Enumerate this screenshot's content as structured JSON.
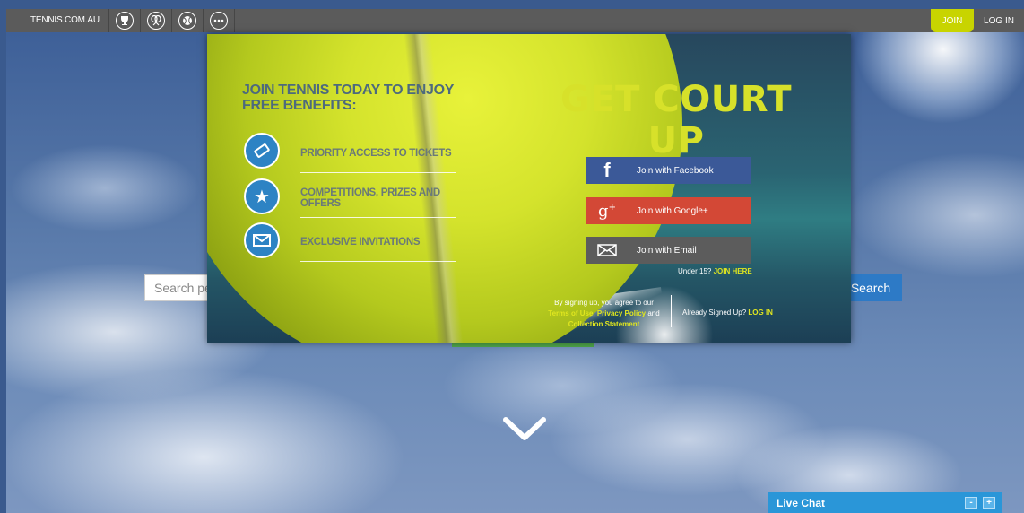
{
  "topbar": {
    "brand": "TENNIS.COM.AU",
    "icons": [
      "trophy-icon",
      "racquets-icon",
      "tennis-ball-icon",
      "more-icon"
    ],
    "join_label": "JOIN",
    "login_label": "LOG IN",
    "accent": "#c8d400"
  },
  "search": {
    "placeholder": "Search per",
    "button_label": "Search"
  },
  "modal": {
    "benefits_title": "JOIN TENNIS TODAY TO ENJOY FREE BENEFITS:",
    "benefits": [
      {
        "icon": "ticket-icon",
        "label": "PRIORITY ACCESS TO TICKETS"
      },
      {
        "icon": "star-icon",
        "label": "COMPETITIONS, PRIZES AND OFFERS"
      },
      {
        "icon": "envelope-icon",
        "label": "EXCLUSIVE INVITATIONS"
      }
    ],
    "headline": "GET COURT UP",
    "buttons": {
      "facebook": "Join with Facebook",
      "google": "Join with Google+",
      "email": "Join with Email"
    },
    "under15_prefix": "Under 15?",
    "under15_link": "JOIN HERE",
    "terms_prefix": "By signing up, you agree to our",
    "terms_link": "Terms of Use,",
    "privacy_link": "Privacy Policy",
    "terms_and": "and",
    "collection_link": "Collection Statement",
    "already_prefix": "Already Signed Up?",
    "already_link": "LOG IN",
    "colors": {
      "headline": "#d7e12a",
      "facebook": "#3b5998",
      "google": "#d34836",
      "email": "#5c5c5c",
      "icon": "#2d83c4"
    }
  },
  "livechat": {
    "label": "Live Chat",
    "minimize": "-",
    "expand": "+"
  }
}
